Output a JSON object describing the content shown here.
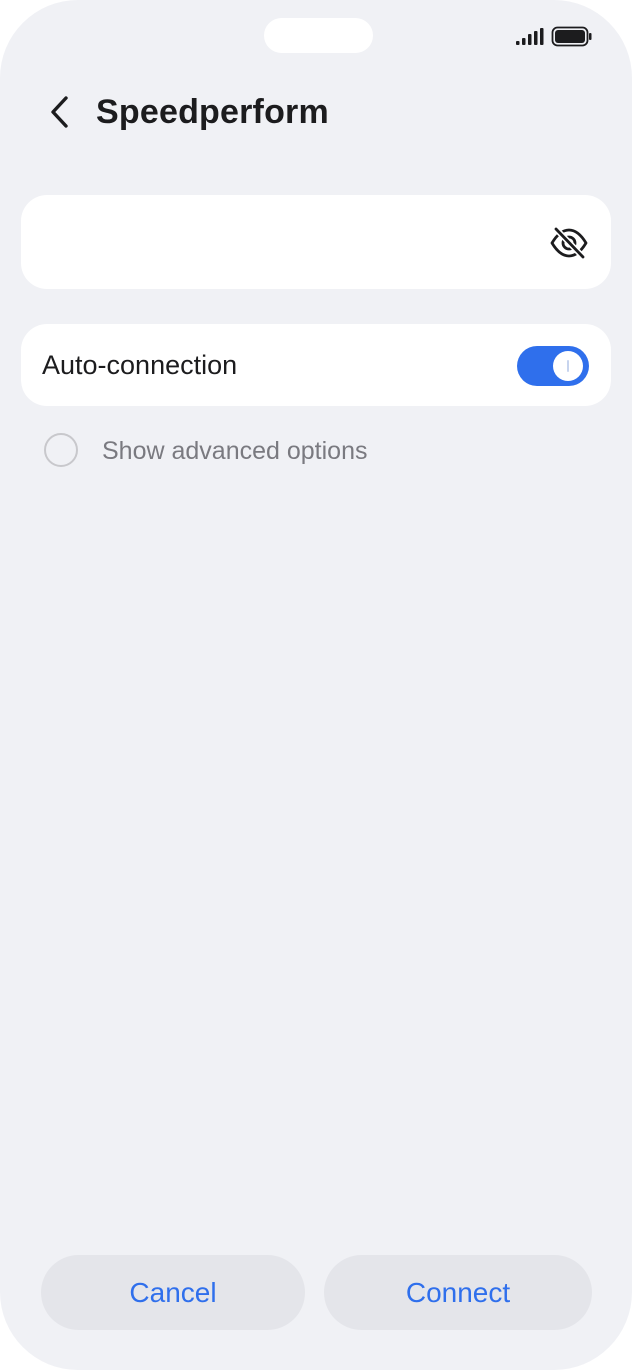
{
  "status_bar": {
    "signal_icon": "cellular-signal-icon",
    "battery_icon": "battery-full-icon"
  },
  "header": {
    "back_icon": "chevron-left-icon",
    "title": "Speedperform"
  },
  "password_field": {
    "value": "",
    "visibility_icon": "eye-off-icon"
  },
  "auto_connection": {
    "label": "Auto-connection",
    "enabled": true
  },
  "advanced_options": {
    "label": "Show advanced options",
    "checked": false
  },
  "buttons": {
    "cancel_label": "Cancel",
    "connect_label": "Connect"
  },
  "colors": {
    "accent": "#2f6fec",
    "background": "#f0f1f5",
    "card": "#ffffff"
  }
}
